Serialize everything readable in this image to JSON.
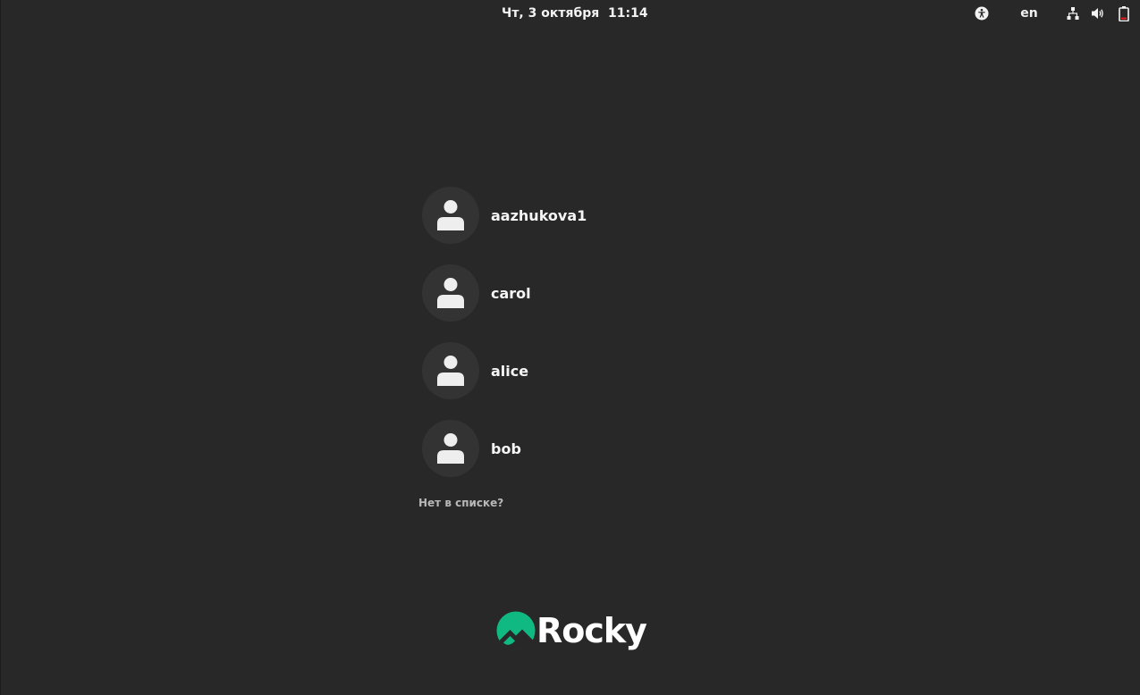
{
  "topbar": {
    "clock": "Чт, 3 октября  11:14",
    "language": "en",
    "icons": {
      "accessibility": "accessibility-icon",
      "network": "network-icon",
      "volume": "volume-icon",
      "battery": "battery-icon"
    }
  },
  "users": [
    {
      "name": "aazhukova1",
      "icon": "user-avatar-icon"
    },
    {
      "name": "carol",
      "icon": "user-avatar-icon"
    },
    {
      "name": "alice",
      "icon": "user-avatar-icon"
    },
    {
      "name": "bob",
      "icon": "user-avatar-icon"
    }
  ],
  "not_listed": "Нет в списке?",
  "logo": {
    "text": "Rocky",
    "color": "#10b981"
  },
  "colors": {
    "background": "#282828",
    "avatar_bg": "#333333",
    "battery_low": "#e01b24"
  }
}
